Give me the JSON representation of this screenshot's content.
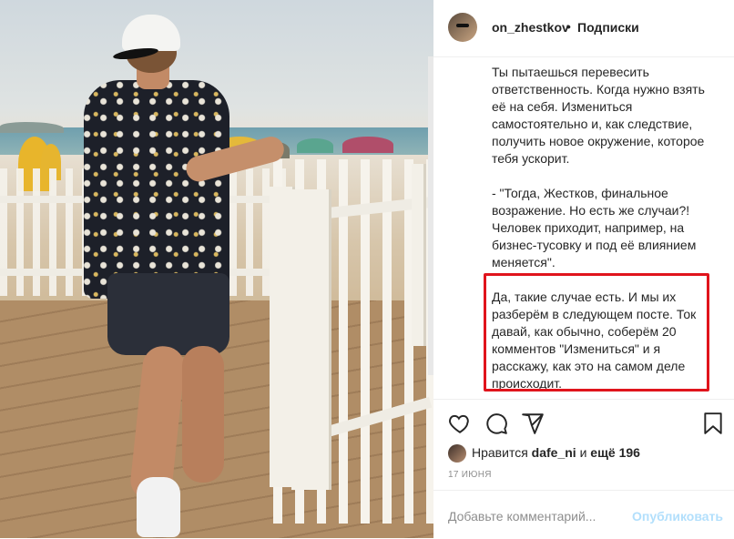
{
  "post": {
    "username": "on_zhestkov",
    "separator": "•",
    "follow_label": "Подписки",
    "caption_paragraphs": [
      "Ты пытаешься перевесить ответственность. Когда нужно взять её на себя. Измениться самостоятельно и, как следствие, получить новое окружение, которое тебя ускорит.",
      "- \"Тогда, Жестков, финальное возражение. Но есть же случаи?! Человек приходит, например, на бизнес-тусовку и под её влиянием меняется\".",
      "Да, такие случае есть. И мы их разберём в следующем посте. Ток давай, как обычно, соберём 20 комментов \"Измениться\" и я расскажу, как это на самом деле происходит."
    ],
    "highlight_color": "#e0141c",
    "likes_prefix": "Нравится ",
    "likes_user": "dafe_ni",
    "likes_middle": " и ",
    "likes_count": "ещё 196",
    "date": "17 ИЮНЯ",
    "comment_placeholder": "Добавьте комментарий...",
    "publish_label": "Опубликовать"
  },
  "icons": {
    "like": "heart-icon",
    "comment": "comment-icon",
    "share": "share-icon",
    "save": "bookmark-icon"
  },
  "colors": {
    "link_disabled": "#b2dffc",
    "muted": "#8e8e8e",
    "text": "#262626"
  }
}
